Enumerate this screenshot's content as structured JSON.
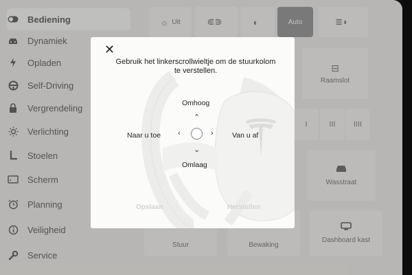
{
  "sidebar": {
    "items": [
      {
        "label": "Bediening",
        "icon": "toggle-icon",
        "glyph": "⊝",
        "active": true
      },
      {
        "label": "Dynamiek",
        "icon": "car-icon",
        "glyph": "▬"
      },
      {
        "label": "Opladen",
        "icon": "lightning-icon",
        "glyph": "ϟ"
      },
      {
        "label": "Self-Driving",
        "icon": "steering-wheel-icon",
        "glyph": "⊛"
      },
      {
        "label": "Vergrendeling",
        "icon": "lock-icon",
        "glyph": "▰"
      },
      {
        "label": "Verlichting",
        "icon": "sun-icon",
        "glyph": "☼"
      },
      {
        "label": "Stoelen",
        "icon": "seat-icon",
        "glyph": "L"
      },
      {
        "label": "Scherm",
        "icon": "display-icon",
        "glyph": "▭"
      },
      {
        "label": "Planning",
        "icon": "alarm-clock-icon",
        "glyph": "⏰"
      },
      {
        "label": "Veiligheid",
        "icon": "info-icon",
        "glyph": "ⓘ"
      },
      {
        "label": "Service",
        "icon": "wrench-icon",
        "glyph": "🔧"
      }
    ]
  },
  "lights": {
    "off_label": "Uit",
    "auto_label": "Auto"
  },
  "tiles": {
    "window_lock": "Raamslot",
    "car_wash": "Wasstraat",
    "steering": "Stuur",
    "monitoring": "Bewaking",
    "glovebox": "Dashboard kast",
    "wiper_1": "I",
    "wiper_2": "II",
    "wiper_3": "III",
    "wiper_4": "IIII"
  },
  "dialog": {
    "instruction": "Gebruik het linkerscrollwieltje om de stuurkolom te verstellen.",
    "up_label": "Omhoog",
    "down_label": "Omlaag",
    "toward_label": "Naar u toe",
    "away_label": "Van u af",
    "save_label": "Opslaan",
    "reset_label": "Herstellen"
  }
}
